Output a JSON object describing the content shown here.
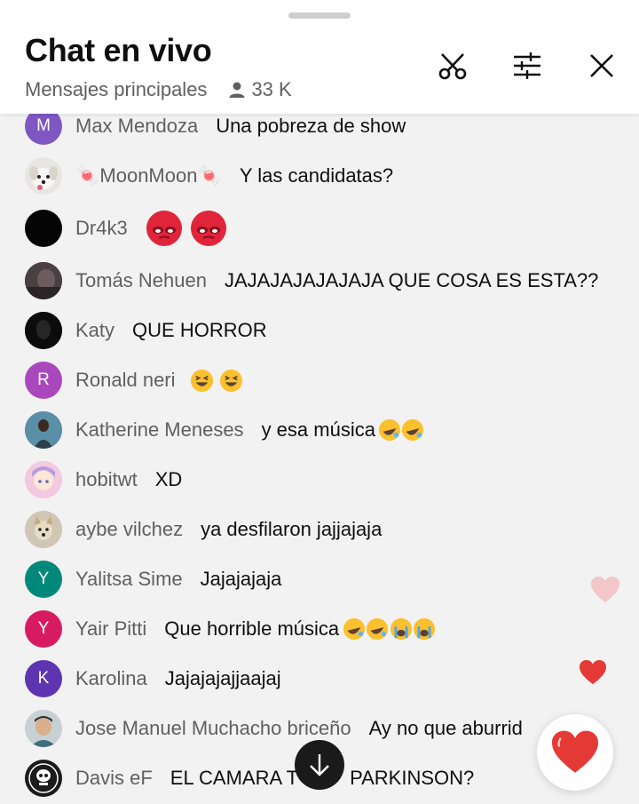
{
  "header": {
    "title": "Chat en vivo",
    "mode": "Mensajes principales",
    "viewers": "33 K"
  },
  "colors": {
    "author": "#606060",
    "avatar_purple": "#7e57c2",
    "avatar_violet": "#ab47bc",
    "avatar_teal": "#00897b",
    "avatar_pink": "#d81b60",
    "avatar_indigo": "#5e35b1",
    "heart": "#e53935"
  },
  "messages": [
    {
      "author": "Max Mendoza",
      "text": "Una pobreza de show",
      "initial": "M"
    },
    {
      "author": "🍬MoonMoon🍬",
      "text": "Y las candidatas?"
    },
    {
      "author": "Dr4k3",
      "text": ""
    },
    {
      "author": "Tomás Nehuen",
      "text": "JAJAJAJAJAJAJA QUE COSA ES ESTA??"
    },
    {
      "author": "Katy",
      "text": "QUE HORROR"
    },
    {
      "author": "Ronald neri",
      "text": "",
      "initial": "R"
    },
    {
      "author": "Katherine Meneses",
      "text": "y esa música"
    },
    {
      "author": "hobitwt",
      "text": "XD"
    },
    {
      "author": "aybe vilchez",
      "text": "ya desfilaron jajjajaja"
    },
    {
      "author": "Yalitsa Sime",
      "text": "Jajajajaja",
      "initial": "Y"
    },
    {
      "author": "Yair Pitti",
      "text": "Que horrible música",
      "initial": "Y"
    },
    {
      "author": "Karolina",
      "text": "Jajajajajjaajaj",
      "initial": "K"
    },
    {
      "author": "Jose Manuel Muchacho briceño",
      "text": "Ay no que aburrid"
    },
    {
      "author": "Davis eF",
      "text": "EL CAMARA T",
      "text_tail": "PARKINSON?"
    }
  ]
}
